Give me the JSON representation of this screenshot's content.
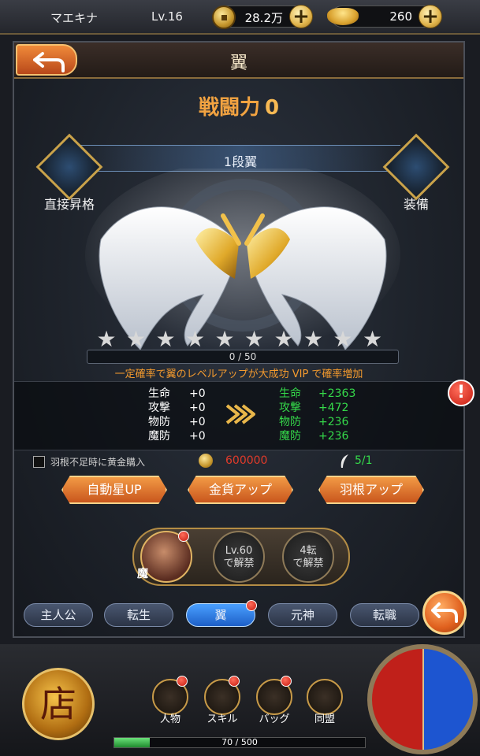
{
  "topbar": {
    "player_name": "マエキナ",
    "level": "Lv.16",
    "coins": "28.2万",
    "gold": "260"
  },
  "panel": {
    "title": "翼",
    "power_label": "戦闘力",
    "power_value": "0",
    "rank_label": "1段翼",
    "upgrade_label": "直接昇格",
    "equip_label": "装備",
    "stars_total": 10,
    "stars_filled": 0,
    "progress_text": "0 / 50",
    "hint": "一定確率で翼のレベルアップが大成功 VIP で確率増加"
  },
  "stats": {
    "current": [
      {
        "name": "生命",
        "value": "+0"
      },
      {
        "name": "攻撃",
        "value": "+0"
      },
      {
        "name": "物防",
        "value": "+0"
      },
      {
        "name": "魔防",
        "value": "+0"
      }
    ],
    "next": [
      {
        "name": "生命",
        "value": "+2363"
      },
      {
        "name": "攻撃",
        "value": "+472"
      },
      {
        "name": "物防",
        "value": "+236"
      },
      {
        "name": "魔防",
        "value": "+236"
      }
    ]
  },
  "buy": {
    "label": "羽根不足時に黄金購入",
    "cost": "600000",
    "feathers": "5/1"
  },
  "actions": {
    "auto": "自動星UP",
    "gold": "金貨アップ",
    "feather": "羽根アップ"
  },
  "skills": {
    "main_tag": "魔",
    "lock1": "Lv.60\nで解禁",
    "lock1_a": "Lv.60",
    "lock1_b": "で解禁",
    "lock2_a": "4転",
    "lock2_b": "で解禁"
  },
  "tabs": [
    "主人公",
    "転生",
    "翼",
    "元神",
    "転職"
  ],
  "active_tab": 2,
  "alert": "!",
  "hud": {
    "shop": "店",
    "menu": [
      "人物",
      "スキル",
      "バッグ",
      "同盟"
    ],
    "exp_text": "70 / 500",
    "exp_fraction": 0.14
  },
  "colors": {
    "accent_orange": "#f2a341",
    "stat_green": "#35d94a",
    "cost_red": "#e23a2a",
    "active_tab": "#1d5fc7"
  }
}
